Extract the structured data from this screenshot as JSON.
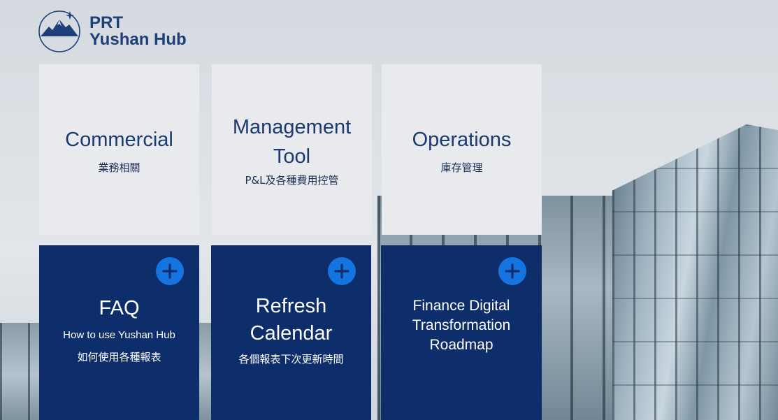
{
  "logo": {
    "line1": "PRT",
    "line2": "Yushan Hub"
  },
  "tiles": {
    "commercial": {
      "title": "Commercial",
      "subtitle": "業務相關"
    },
    "management": {
      "title_line1": "Management",
      "title_line2": "Tool",
      "subtitle": "P&L及各種費用控管"
    },
    "operations": {
      "title": "Operations",
      "subtitle": "庫存管理"
    },
    "faq": {
      "title": "FAQ",
      "subtitle_en": "How to use Yushan Hub",
      "subtitle_zh": "如何使用各種報表"
    },
    "refresh": {
      "title_line1": "Refresh",
      "title_line2": "Calendar",
      "subtitle": "各個報表下次更新時間"
    },
    "finance": {
      "title_line1": "Finance Digital",
      "title_line2": "Transformation",
      "title_line3": "Roadmap"
    }
  },
  "icons": {
    "expand": "plus-icon",
    "logo": "mountain-star-icon"
  },
  "colors": {
    "dark_tile": "#0d2d6b",
    "light_tile": "#e9eaee",
    "accent": "#1474e0",
    "brand_text": "#1f3f79"
  }
}
